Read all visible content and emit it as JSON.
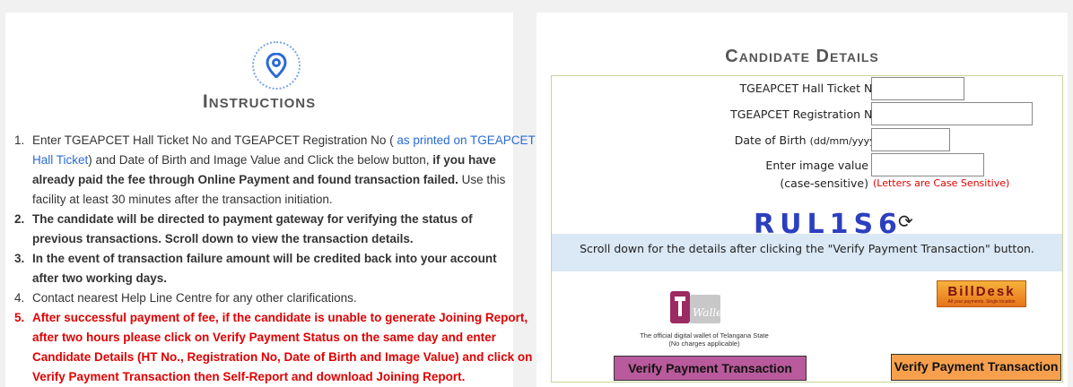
{
  "instructions": {
    "title": "Instructions",
    "items": [
      {
        "num": "1.",
        "lines": [
          [
            "Enter TGEAPCET Hall Ticket No and TGEAPCET Registration No ( ",
            "as printed on TGEAPCET"
          ],
          [
            "Hall Ticket",
            ") and Date of Birth and Image Value and Click the below button, ",
            "if you have"
          ],
          [
            "already paid the fee through Online Payment and found transaction failed.",
            " Use this"
          ],
          [
            "facility at least 30 minutes after the transaction initiation."
          ]
        ]
      },
      {
        "num": "2.",
        "lines": [
          "The candidate will be directed to payment gateway for verifying the status of",
          "previous transactions. Scroll down to view the transaction details."
        ]
      },
      {
        "num": "3.",
        "lines": [
          "In the event of transaction failure amount will be credited back into your account",
          "after two working days."
        ]
      },
      {
        "num": "4.",
        "lines": [
          "Contact nearest Help Line Centre for any other clarifications."
        ]
      },
      {
        "num": "5.",
        "lines": [
          "After successful payment of fee, if the candidate is unable to generate Joining Report,",
          "after two hours please click on Verify Payment Status on the same day and enter",
          "Candidate Details (HT No., Registration No, Date of Birth and Image Value) and click on",
          "Verify Payment Transaction then Self-Report and download Joining Report."
        ]
      }
    ]
  },
  "candidate": {
    "title": "Candidate Details",
    "hall_ticket_label": "TGEAPCET Hall Ticket No",
    "hall_ticket_value": "",
    "registration_label": "TGEAPCET Registration No",
    "registration_value": "",
    "dob_label": "Date of Birth",
    "dob_format": "(dd/mm/yyyy)",
    "dob_value": "",
    "image_label_1": "Enter image value",
    "image_label_2": "(case-sensitive)",
    "image_value": "",
    "case_hint": "(Letters are Case Sensitive)",
    "captcha": "RUL1S6",
    "scroll_note": "Scroll down for the details after clicking the \"Verify Payment Transaction\" button."
  },
  "twallet": {
    "logo_text": "Wallet",
    "caption_1": "The official digital wallet of Telangana State",
    "caption_2": "(No charges applicable)",
    "button": "Verify Payment Transaction"
  },
  "billdesk": {
    "logo_text": "BillDesk",
    "logo_sub": "All your payments. Single location",
    "button": "Verify Payment Transaction"
  },
  "colors": {
    "link_blue": "#2a6ad6",
    "alert_red": "#e00000",
    "captcha_blue": "#2c3fbf",
    "twallet_button": "#b85a9b",
    "billdesk_button": "#f6a04d",
    "note_bg": "#dbe8f5"
  }
}
